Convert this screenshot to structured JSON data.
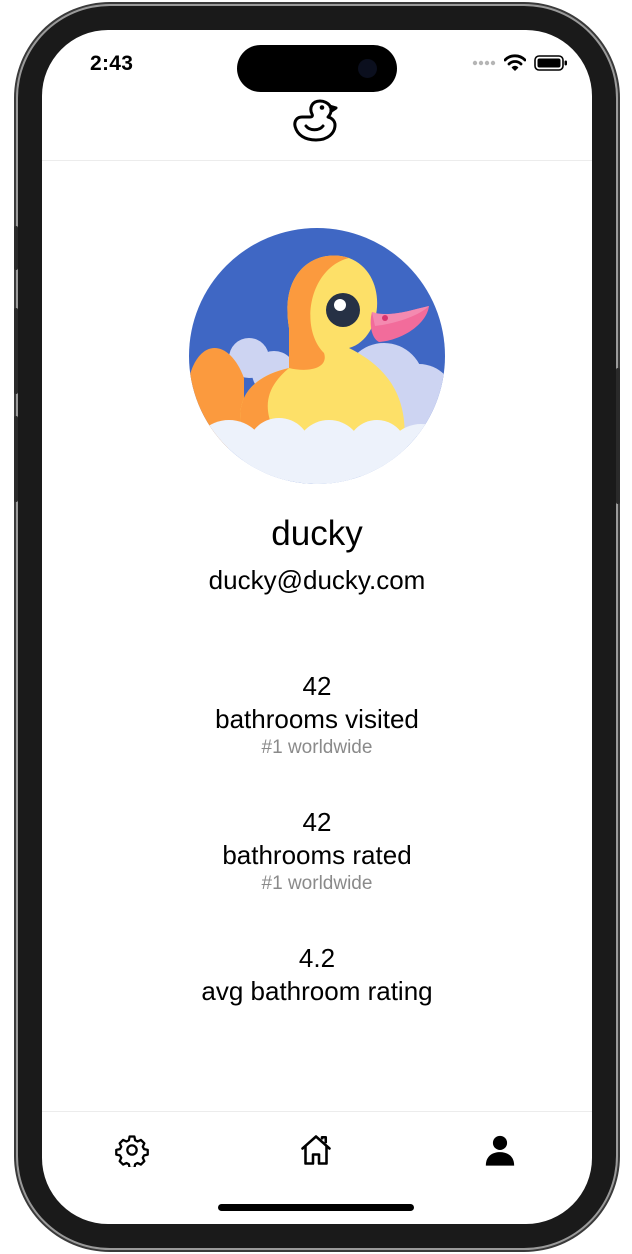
{
  "status_bar": {
    "time": "2:43"
  },
  "header": {
    "logo_icon": "duck-logo-icon"
  },
  "profile": {
    "avatar_icon": "rubber-duck-avatar",
    "username": "ducky",
    "email": "ducky@ducky.com"
  },
  "stats": [
    {
      "value": "42",
      "label": "bathrooms visited",
      "rank": "#1 worldwide"
    },
    {
      "value": "42",
      "label": "bathrooms rated",
      "rank": "#1 worldwide"
    },
    {
      "value": "4.2",
      "label": "avg bathroom rating"
    }
  ],
  "tab_bar": {
    "items": [
      {
        "icon": "gear-icon",
        "name": "settings"
      },
      {
        "icon": "home-icon",
        "name": "home"
      },
      {
        "icon": "person-icon",
        "name": "profile",
        "selected": true
      }
    ]
  },
  "colors": {
    "avatar_background": "#3F67C4",
    "duck_yellow": "#FDE068",
    "duck_orange": "#FB9A3E",
    "beak_pink": "#F26C9B",
    "secondary_text": "#8A8A8A"
  }
}
